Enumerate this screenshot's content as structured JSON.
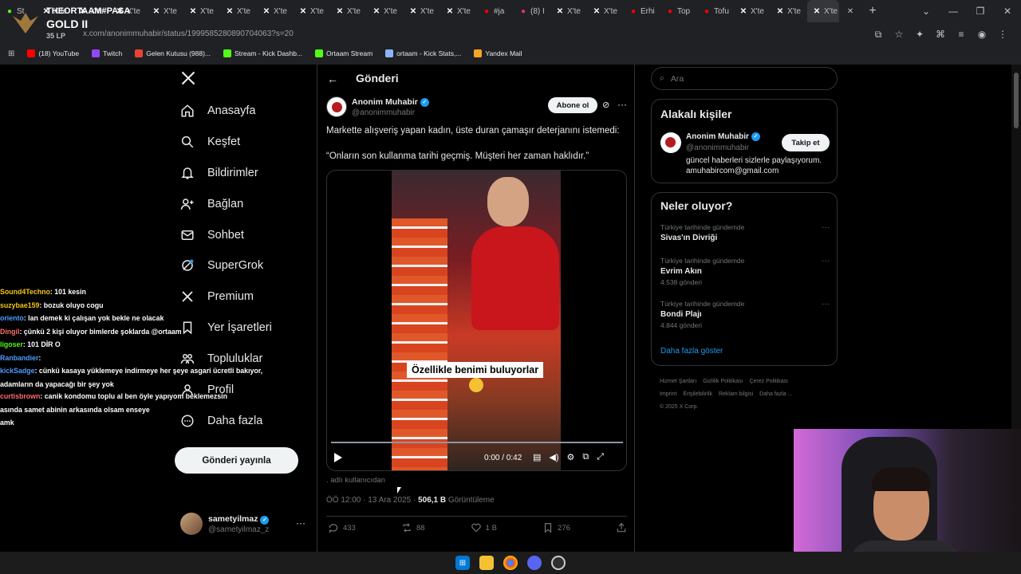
{
  "overlay": {
    "player": "THEORTAAM#PASA",
    "tier": "GOLD II",
    "lp": "35 LP"
  },
  "browser": {
    "tabs": [
      {
        "label": "St",
        "icon": "stream-icon",
        "color": "#53fc18"
      },
      {
        "label": "X'te",
        "icon": "x-icon",
        "color": "#ffffff"
      },
      {
        "label": "X'te",
        "icon": "x-icon",
        "color": "#ffffff"
      },
      {
        "label": "X'te",
        "icon": "x-icon",
        "color": "#ffffff"
      },
      {
        "label": "X'te",
        "icon": "x-icon",
        "color": "#ffffff"
      },
      {
        "label": "X'te",
        "icon": "x-icon",
        "color": "#ffffff"
      },
      {
        "label": "X'te",
        "icon": "x-icon",
        "color": "#ffffff"
      },
      {
        "label": "X'te",
        "icon": "x-icon",
        "color": "#ffffff"
      },
      {
        "label": "X'te",
        "icon": "x-icon",
        "color": "#ffffff"
      },
      {
        "label": "X'te",
        "icon": "x-icon",
        "color": "#ffffff"
      },
      {
        "label": "X'te",
        "icon": "x-icon",
        "color": "#ffffff"
      },
      {
        "label": "X'te",
        "icon": "x-icon",
        "color": "#ffffff"
      },
      {
        "label": "X'te",
        "icon": "x-icon",
        "color": "#ffffff"
      },
      {
        "label": "#ja",
        "icon": "youtube-icon",
        "color": "#ff0000"
      },
      {
        "label": "(8) I",
        "icon": "instagram-icon",
        "color": "#e1306c"
      },
      {
        "label": "X'te",
        "icon": "x-icon",
        "color": "#ffffff"
      },
      {
        "label": "X'te",
        "icon": "x-icon",
        "color": "#ffffff"
      },
      {
        "label": "Erhi",
        "icon": "youtube-icon",
        "color": "#ff0000"
      },
      {
        "label": "Top",
        "icon": "youtube-icon",
        "color": "#ff0000"
      },
      {
        "label": "Tofu",
        "icon": "youtube-icon",
        "color": "#ff0000"
      },
      {
        "label": "X'te",
        "icon": "x-icon",
        "color": "#ffffff"
      },
      {
        "label": "X'te",
        "icon": "x-icon",
        "color": "#ffffff"
      },
      {
        "label": "X'te",
        "icon": "x-icon",
        "color": "#ffffff"
      }
    ],
    "url": "x.com/anonimmuhabir/status/1999585280890704063?s=20",
    "bookmarks": [
      {
        "label": "(18) YouTube",
        "color": "#ff0000"
      },
      {
        "label": "Twitch",
        "color": "#9146ff"
      },
      {
        "label": "Gelen Kutusu (988)...",
        "color": "#ea4335"
      },
      {
        "label": "Stream - Kick Dashb...",
        "color": "#53fc18"
      },
      {
        "label": "Ortaam Stream",
        "color": "#53fc18"
      },
      {
        "label": "ortaam - Kick Stats,...",
        "color": "#8ab4f8"
      },
      {
        "label": "Yandex Mail",
        "color": "#f5a623"
      }
    ]
  },
  "nav": {
    "items": [
      {
        "label": "Anasayfa",
        "icon": "home-icon"
      },
      {
        "label": "Keşfet",
        "icon": "search-icon"
      },
      {
        "label": "Bildirimler",
        "icon": "bell-icon"
      },
      {
        "label": "Bağlan",
        "icon": "add-person-icon"
      },
      {
        "label": "Sohbet",
        "icon": "mail-icon"
      },
      {
        "label": "SuperGrok",
        "icon": "grok-icon"
      },
      {
        "label": "Premium",
        "icon": "x-icon"
      },
      {
        "label": "Yer İşaretleri",
        "icon": "bookmark-icon"
      },
      {
        "label": "Topluluklar",
        "icon": "communities-icon"
      },
      {
        "label": "Profil",
        "icon": "profile-icon"
      },
      {
        "label": "Daha fazla",
        "icon": "more-circle-icon"
      }
    ],
    "post_button": "Gönderi yayınla",
    "account": {
      "name": "sametyilmaz",
      "handle": "@sametyilmaz_z"
    }
  },
  "chat": [
    {
      "user": "Sound4Techno",
      "color": "#f5c518",
      "text": ": 101 kesin"
    },
    {
      "user": "suzybae159",
      "color": "#f5c518",
      "text": ": bozuk oluyo cogu"
    },
    {
      "user": "oriento",
      "color": "#4f9cff",
      "text": ": lan demek ki çalışan yok bekle ne olacak"
    },
    {
      "user": "Dingil",
      "color": "#ff6b6b",
      "text": ": çünkü 2 kişi oluyor bimlerde şoklarda @ortaam"
    },
    {
      "user": "ligoser",
      "color": "#53fc18",
      "text": ": 101 DİR O"
    },
    {
      "user": "Ranbandier",
      "color": "#4f9cff",
      "text": ":"
    },
    {
      "user": "kickSadge",
      "color": "#4f9cff",
      "text": ": cünkü kasaya yüklemeye indirmeye her şeye asgari ücretli bakıyor,"
    },
    {
      "user": "",
      "color": "#ffffff",
      "text": "adamların da yapacağı bir şey yok"
    },
    {
      "user": "curtisbrown",
      "color": "#ff6b6b",
      "text": ": canik kondomu toplu al ben öyle yapıyom beklemezsin"
    },
    {
      "user": "",
      "color": "#ffffff",
      "text": "asında samet abinin arkasında olsam enseye"
    },
    {
      "user": "",
      "color": "#ffffff",
      "text": "amk"
    }
  ],
  "post": {
    "header_title": "Gönderi",
    "author": {
      "name": "Anonim Muhabir",
      "handle": "@anonimmuhabir"
    },
    "subscribe_label": "Abone ol",
    "text_line1": "Markette alışveriş yapan kadın, üste duran çamaşır deterjanını istemedi:",
    "text_line2": "“Onların son kullanma tarihi geçmiş. Müşteri her zaman haklıdır.”",
    "video": {
      "caption": "Özellikle benimi buluyorlar",
      "time": "0:00 / 0:42",
      "progress": 0
    },
    "source": ". adlı kullanıcıdan",
    "timestamp": "ÖÖ 12:00 · 13 Ara 2025 · ",
    "views": "506,1 B",
    "views_label": "Görüntüleme",
    "replies": "433",
    "reposts": "88",
    "likes": "1 B",
    "bookmarks": "276"
  },
  "right": {
    "search_placeholder": "Ara",
    "related_title": "Alakalı kişiler",
    "related_person": {
      "name": "Anonim Muhabir",
      "handle": "@anonimmuhabir",
      "bio1": "güncel haberleri sizlerle paylaşıyorum.",
      "bio2": "amuhabircom@gmail.com"
    },
    "follow_label": "Takip et",
    "trends_title": "Neler oluyor?",
    "trends": [
      {
        "context": "Türkiye tarihinde gündemde",
        "name": "Sivas'ın Divriği",
        "count": ""
      },
      {
        "context": "Türkiye tarihinde gündemde",
        "name": "Evrim Akın",
        "count": "4.538 gönderi"
      },
      {
        "context": "Türkiye tarihinde gündemde",
        "name": "Bondi Plajı",
        "count": "4.844 gönderi"
      }
    ],
    "show_more": "Daha fazla göster",
    "footer": [
      "Hizmet Şartları",
      "Gizlilik Politikası",
      "Çerez Politikası",
      "Imprint",
      "Erişilebilirlik",
      "Reklam bilgisi",
      "Daha fazla ...",
      "© 2025 X Corp."
    ]
  }
}
